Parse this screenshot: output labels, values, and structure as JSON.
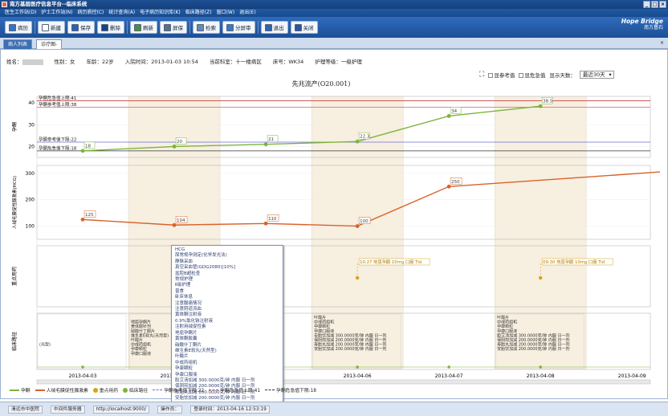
{
  "window": {
    "title": "南方基层医疗信息平台--临床系统",
    "controls": [
      "_",
      "□",
      "×"
    ]
  },
  "menu": [
    "医生工作站(D)",
    "护士工作站(N)",
    "病历质控(C)",
    "统计查询(A)",
    "电子病历知识库(K)",
    "临床路径(Z)",
    "窗口(W)",
    "退出(E)"
  ],
  "toolbar": [
    {
      "label": "病历",
      "icon": "record-icon",
      "color": "#3b6fc6"
    },
    {
      "label": "新建",
      "icon": "new-icon",
      "color": "#ffffff"
    },
    {
      "label": "保存",
      "icon": "save-icon",
      "color": "#2d5fb8"
    },
    {
      "label": "删除",
      "icon": "delete-icon",
      "color": "#1d3f86"
    },
    {
      "label": "刷新",
      "icon": "refresh-icon",
      "color": "#4a8f3f"
    },
    {
      "label": "屏保",
      "icon": "lock-icon",
      "color": "#5a6f8f"
    },
    {
      "label": "检索",
      "icon": "search-icon",
      "color": "#6a86b8"
    },
    {
      "label": "分屏审",
      "icon": "split-icon",
      "color": "#3a78c8"
    },
    {
      "label": "退出",
      "icon": "exit-icon",
      "color": "#2f62b0"
    },
    {
      "label": "关闭",
      "icon": "close-icon",
      "color": "#2a56a4"
    }
  ],
  "brand": {
    "line1": "Hope Bridge",
    "line2": "南方基石"
  },
  "tabs": [
    {
      "label": "病人列表"
    },
    {
      "label": "诊疗图-"
    }
  ],
  "patient": {
    "name_label": "姓名：",
    "sex": "性别：女",
    "age": "年龄：22岁",
    "admit": "入院时间：2013-01-03 10:54",
    "dept": "当前科室：十一楼病区",
    "bed": "床号：WK34",
    "care": "护理等级：一级护理"
  },
  "options": {
    "ref_label": "显参考值",
    "crit_label": "显危急值",
    "days_label": "显示天数：",
    "days_value": "最近30天"
  },
  "chart_data": {
    "type": "line",
    "title": "先兆流产(O20.001)",
    "x": [
      "2013-04-03",
      "2013-04-04",
      "2013-04-05",
      "2013-04-06",
      "2013-04-07",
      "2013-04-08",
      "2013-04-09"
    ],
    "series": [
      {
        "name": "孕酮",
        "color": "#7cb43a",
        "points": [
          [
            0.5,
            18
          ],
          [
            1.5,
            20
          ],
          [
            2.5,
            21
          ],
          [
            3.5,
            22.3
          ],
          [
            4.5,
            34
          ],
          [
            5.5,
            38.5
          ]
        ],
        "labels": [
          "18",
          "20",
          "21",
          "22.3",
          "34",
          "38.5"
        ]
      },
      {
        "name": "人绒毛膜促性腺激素",
        "color": "#d9622b",
        "points": [
          [
            0.5,
            125
          ],
          [
            1.5,
            104
          ],
          [
            2.5,
            110
          ],
          [
            3.5,
            100
          ],
          [
            4.5,
            250
          ],
          [
            7.0,
            310
          ]
        ],
        "labels": [
          "125",
          "104",
          "110",
          "100",
          "250",
          ""
        ]
      }
    ],
    "panel1": {
      "ylabel": "孕酮",
      "yticks": [
        20,
        30,
        40
      ],
      "ylim": [
        15,
        43
      ],
      "reflines": [
        {
          "name": "孕酮危急值上限:41",
          "y": 41,
          "color": "#c84040"
        },
        {
          "name": "孕酮参考值上限:38",
          "y": 38,
          "color": "#d47a7a"
        },
        {
          "name": "孕酮参考值下限:22",
          "y": 22,
          "color": "#6b6bd6"
        },
        {
          "name": "孕酮危急值下限:18",
          "y": 18,
          "color": "#333333"
        }
      ]
    },
    "panel2": {
      "ylabel": "人绒毛膜促性腺激素(HCG)",
      "yticks": [
        100,
        200,
        300
      ],
      "ylim": [
        50,
        330
      ]
    },
    "panel3": {
      "ylabel": "重点用药",
      "drugs": [
        {
          "x": 3.5,
          "text": "10:27 地屈孕酮 10mg 口服 Tid"
        },
        {
          "x": 5.5,
          "text": "09:30 地屈孕酮 10mg 口服 Tid"
        }
      ]
    },
    "panel4": {
      "ylabel": "临床路径",
      "cols": [
        {
          "x": 0.0,
          "lines": [
            "",
            "",
            "",
            "",
            "",
            "",
            "",
            "",
            "",
            "",
            "",
            "",
            "",
            "",
            ""
          ]
        },
        {
          "x": 0.05,
          "lines": [
            "",
            "",
            "",
            "",
            "",
            "",
            "",
            "",
            "",
            "",
            "",
            "",
            "",
            "",
            ""
          ]
        },
        {
          "x": 0.0,
          "lines": [
            "",
            "",
            "",
            "",
            "",
            "",
            "",
            "",
            "",
            "",
            "",
            "",
            "",
            "",
            ""
          ]
        }
      ],
      "cells": [
        {
          "col": 0,
          "text": [
            "",
            "",
            "",
            "",
            "",
            "",
            "(光型)",
            "",
            "",
            "",
            "",
            "",
            "",
            ""
          ]
        },
        {
          "col": 1,
          "text": [
            "",
            "地屈孕酮片",
            "黄体酮针剂",
            "硝酸什丁酮片",
            "维生素E软丸(天然型)",
            "叶酸片",
            "中成药组机",
            "孕康颗粒",
            "孕康口服液",
            "",
            "",
            "",
            "",
            ""
          ]
        },
        {
          "col": 3,
          "text": [
            "叶酸片",
            "中成药组机",
            "孕康颗粒",
            "孕康口服液",
            "安胎饮加减 300.0000克/钟 内服 日一剂",
            "保阴煎加减 200.0000克/钟 内服 日一剂",
            "寿胎丸加减 200.0000克/钟 内服 日一剂",
            "安胎饮加减 200.0000克/钟 内服 日一剂",
            "",
            "",
            "",
            "",
            ""
          ]
        },
        {
          "col": 5,
          "text": [
            "叶酸片",
            "中成药组机",
            "孕康颗粒",
            "孕康口服液",
            "胶艾汤加减 300.0000克/钟 内服 日一剂",
            "保阴煎加减 200.0000克/钟 内服 日一剂",
            "寿胎丸加减 200.0000克/钟 内服 日一剂",
            "安胎饮加减 200.0000克/钟 内服 日一剂",
            "",
            "",
            "",
            ""
          ]
        }
      ]
    },
    "legend": [
      {
        "label": "孕酮",
        "color": "#7cb43a",
        "type": "line"
      },
      {
        "label": "人绒毛膜促性腺激素",
        "color": "#d9622b",
        "type": "line"
      },
      {
        "label": "重点用药",
        "color": "#d6a21a",
        "type": "dot"
      },
      {
        "label": "临床路径",
        "color": "#7cb43a",
        "type": "dot"
      },
      {
        "label": "孕酮参考值下限:22",
        "color": "#6b6bd6",
        "type": "dash"
      },
      {
        "label": "孕酮危急值上限:41",
        "color": "#c84040",
        "type": "dash"
      },
      {
        "label": "孕酮危急值下限:18",
        "color": "#333333",
        "type": "dash"
      }
    ]
  },
  "popup": [
    "HCG",
    "尿常规孕测定(化学发光法)",
    "静脉采血",
    "真空采血管(GDG2080)[10%]",
    "盆腔B超检查",
    "常规护理",
    "Ⅱ级护理",
    "普食",
    "卧床休息",
    "注意腹痛情况",
    "注意阴道流血",
    "黄体酮注射液",
    "0.9%氯化钠注射液",
    "注射用绒促性素",
    "地屈孕酮片",
    "黄体酮胶囊",
    "硝酸什丁酮片",
    "维生素E软丸(天然型)",
    "叶酸片",
    "中成药组机",
    "孕康颗粒",
    "孕康口服液",
    "胶艾汤加减 300.0000克/钟 内服 日一剂",
    "保阴煎加减 200.0000克/钟 内服 日一剂",
    "寿胎丸加减 200.0000克/钟 内服 日一剂",
    "安胎饮加减 200.0000克/钟 内服 日一剂"
  ],
  "status": [
    "清远市中医院",
    "中间件服务器",
    "http://localhost:9000/",
    "操作员：",
    "登录时间：2013-04-16 12:53:19"
  ]
}
